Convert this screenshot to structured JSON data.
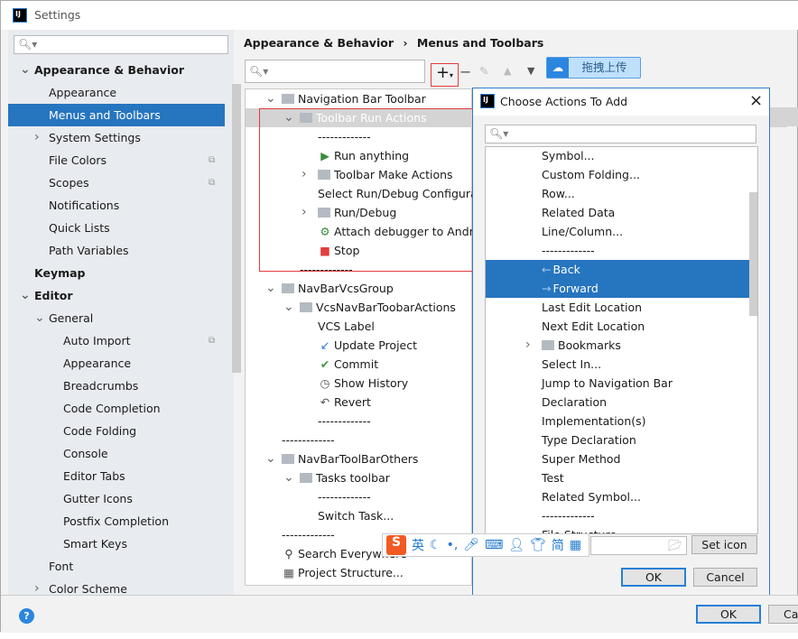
{
  "window": {
    "title": "Settings"
  },
  "sidebar": {
    "search_placeholder": "",
    "items": [
      {
        "label": "Appearance & Behavior",
        "level": 0,
        "bold": true,
        "expander": "open"
      },
      {
        "label": "Appearance",
        "level": 1
      },
      {
        "label": "Menus and Toolbars",
        "level": 1,
        "selected": true
      },
      {
        "label": "System Settings",
        "level": 1,
        "expander": "closed"
      },
      {
        "label": "File Colors",
        "level": 1,
        "badge": true
      },
      {
        "label": "Scopes",
        "level": 1,
        "badge": true
      },
      {
        "label": "Notifications",
        "level": 1
      },
      {
        "label": "Quick Lists",
        "level": 1
      },
      {
        "label": "Path Variables",
        "level": 1
      },
      {
        "label": "Keymap",
        "level": 0,
        "bold": true
      },
      {
        "label": "Editor",
        "level": 0,
        "bold": true,
        "expander": "open"
      },
      {
        "label": "General",
        "level": 1,
        "expander": "open"
      },
      {
        "label": "Auto Import",
        "level": 2,
        "badge": true
      },
      {
        "label": "Appearance",
        "level": 2
      },
      {
        "label": "Breadcrumbs",
        "level": 2
      },
      {
        "label": "Code Completion",
        "level": 2
      },
      {
        "label": "Code Folding",
        "level": 2
      },
      {
        "label": "Console",
        "level": 2
      },
      {
        "label": "Editor Tabs",
        "level": 2
      },
      {
        "label": "Gutter Icons",
        "level": 2
      },
      {
        "label": "Postfix Completion",
        "level": 2
      },
      {
        "label": "Smart Keys",
        "level": 2
      },
      {
        "label": "Font",
        "level": 1
      },
      {
        "label": "Color Scheme",
        "level": 1,
        "expander": "closed"
      }
    ]
  },
  "breadcrumb": {
    "parent": "Appearance & Behavior",
    "separator": "›",
    "current": "Menus and Toolbars"
  },
  "toolbar": {
    "upload_label": "拖拽上传"
  },
  "tree": [
    {
      "label": "Navigation Bar Toolbar",
      "indent": 0,
      "expander": "open",
      "icon": "folder"
    },
    {
      "label": "Toolbar Run Actions",
      "indent": 1,
      "expander": "open",
      "icon": "folder",
      "selected": true
    },
    {
      "label": "-------------",
      "indent": 2
    },
    {
      "label": "Run anything",
      "indent": 2,
      "icon": "run"
    },
    {
      "label": "Toolbar Make Actions",
      "indent": 2,
      "expander": "closed",
      "icon": "folder"
    },
    {
      "label": "Select Run/Debug Configuration",
      "indent": 2
    },
    {
      "label": "Run/Debug",
      "indent": 2,
      "expander": "closed",
      "icon": "folder"
    },
    {
      "label": "Attach debugger to Android process",
      "indent": 2,
      "icon": "android"
    },
    {
      "label": "Stop",
      "indent": 2,
      "icon": "stop"
    },
    {
      "label": "-------------",
      "indent": 1
    },
    {
      "label": "NavBarVcsGroup",
      "indent": 0,
      "expander": "open",
      "icon": "folder"
    },
    {
      "label": "VcsNavBarToobarActions",
      "indent": 1,
      "expander": "open",
      "icon": "folder"
    },
    {
      "label": "VCS Label",
      "indent": 2
    },
    {
      "label": "Update Project",
      "indent": 2,
      "icon": "update"
    },
    {
      "label": "Commit",
      "indent": 2,
      "icon": "check"
    },
    {
      "label": "Show History",
      "indent": 2,
      "icon": "history"
    },
    {
      "label": "Revert",
      "indent": 2,
      "icon": "revert"
    },
    {
      "label": "-------------",
      "indent": 2
    },
    {
      "label": "-------------",
      "indent": 0
    },
    {
      "label": "NavBarToolBarOthers",
      "indent": 0,
      "expander": "open",
      "icon": "folder"
    },
    {
      "label": "Tasks toolbar",
      "indent": 1,
      "expander": "open",
      "icon": "folder"
    },
    {
      "label": "-------------",
      "indent": 2
    },
    {
      "label": "Switch Task...",
      "indent": 2
    },
    {
      "label": "-------------",
      "indent": 0
    },
    {
      "label": "Search Everywhere",
      "indent": 0,
      "icon": "search"
    },
    {
      "label": "Project Structure...",
      "indent": 0,
      "icon": "structure"
    }
  ],
  "dialog": {
    "title": "Choose Actions To Add",
    "search_placeholder": "",
    "items": [
      {
        "label": "Symbol..."
      },
      {
        "label": "Custom Folding..."
      },
      {
        "label": "Row..."
      },
      {
        "label": "Related Data"
      },
      {
        "label": "Line/Column..."
      },
      {
        "label": "-------------"
      },
      {
        "label": "Back",
        "selected": true,
        "icon": "arrow-left"
      },
      {
        "label": "Forward",
        "selected": true,
        "icon": "arrow-right"
      },
      {
        "label": "Last Edit Location"
      },
      {
        "label": "Next Edit Location"
      },
      {
        "label": "Bookmarks",
        "expander": "closed",
        "icon": "folder"
      },
      {
        "label": "Select In..."
      },
      {
        "label": "Jump to Navigation Bar"
      },
      {
        "label": "Declaration"
      },
      {
        "label": "Implementation(s)"
      },
      {
        "label": "Type Declaration"
      },
      {
        "label": "Super Method"
      },
      {
        "label": "Test"
      },
      {
        "label": "Related Symbol..."
      },
      {
        "label": "-------------"
      },
      {
        "label": "File Structure"
      }
    ],
    "icon_path_value": "",
    "set_icon_label": "Set icon",
    "ok_label": "OK",
    "cancel_label": "Cancel"
  },
  "ime": {
    "lang": "英"
  },
  "footer": {
    "help": "?",
    "ok_label": "OK",
    "cancel_label": "Cancel"
  },
  "colors": {
    "selection": "#2675bf",
    "accent": "#2680d6",
    "highlight_box": "#e23b3b"
  }
}
